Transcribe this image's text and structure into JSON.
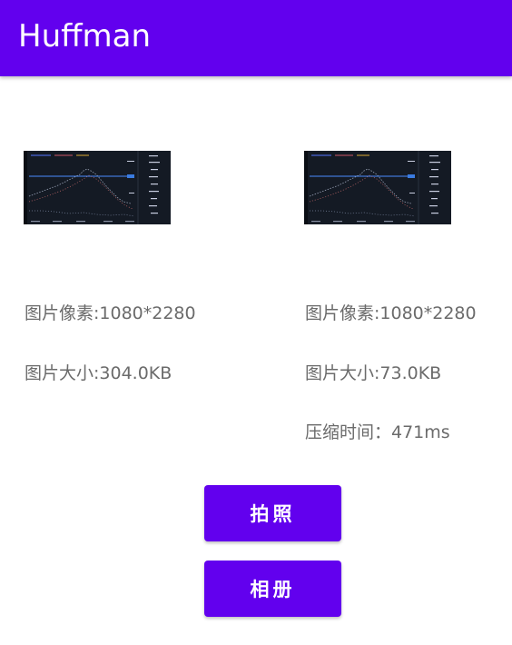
{
  "app_bar": {
    "title": "Huffman",
    "color": "#6200EE"
  },
  "original": {
    "image_icon": "chart-screenshot-thumbnail",
    "pixels_text": "图片像素:1080*2280",
    "size_text": "图片大小:304.0KB"
  },
  "compressed": {
    "image_icon": "chart-screenshot-thumbnail",
    "pixels_text": "图片像素:1080*2280",
    "size_text": "图片大小:73.0KB",
    "time_text": "压缩时间：471ms"
  },
  "buttons": {
    "camera_label": "拍照",
    "album_label": "相册"
  }
}
